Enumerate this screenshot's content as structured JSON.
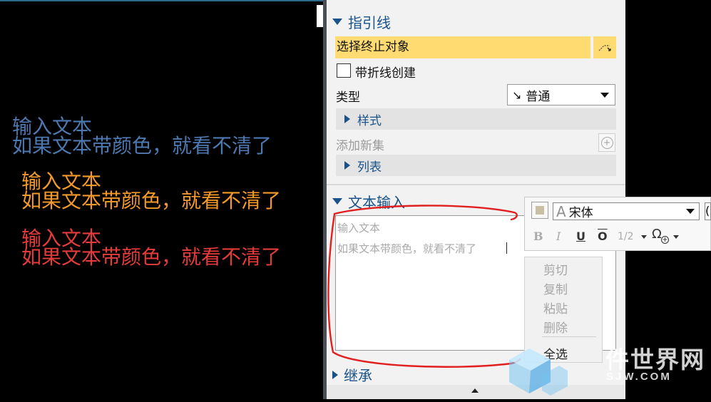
{
  "cad_lines": [
    {
      "line1": "输入文本",
      "line2": "如果文本带颜色，就看不清了"
    },
    {
      "line1": "输入文本",
      "line2": "如果文本带颜色，就看不清了"
    },
    {
      "line1": "输入文本",
      "line2": "如果文本带颜色，就看不清了"
    }
  ],
  "colors": {
    "cad_blue": "#4d79b0",
    "cad_orange": "#f39a2a",
    "cad_red": "#e53b3b",
    "section_title": "#19538a",
    "highlight": "#ffdb72"
  },
  "panel": {
    "leader_section": "指引线",
    "select_end": "选择终止对象",
    "select_button_icon": "pick-point-icon",
    "bend_checkbox": {
      "label": "带折线创建",
      "checked": false
    },
    "type_label": "类型",
    "type_select": {
      "icon": "↘",
      "value": "普通"
    },
    "style_section": "样式",
    "add_set": "添加新集",
    "list_section": "列表",
    "text_input_section": "文本输入",
    "inherit_section": "继承"
  },
  "text_editor": {
    "line1": "输入文本",
    "line2": "如果文本带颜色，就看不清了"
  },
  "format_toolbar": {
    "font": "宋体",
    "font_size_partial": "(",
    "bold": "B",
    "italic": "I",
    "underline": "U",
    "overline": "O",
    "fraction": "1/2",
    "symbol": "Ω"
  },
  "context_menu": {
    "items": [
      {
        "label": "剪切",
        "enabled": false
      },
      {
        "label": "复制",
        "enabled": false
      },
      {
        "label": "粘贴",
        "enabled": false
      },
      {
        "label": "删除",
        "enabled": false
      },
      {
        "label": "全选",
        "enabled": true
      }
    ]
  },
  "watermark": {
    "text": "件世界网",
    "domain": "SJW.COM"
  }
}
